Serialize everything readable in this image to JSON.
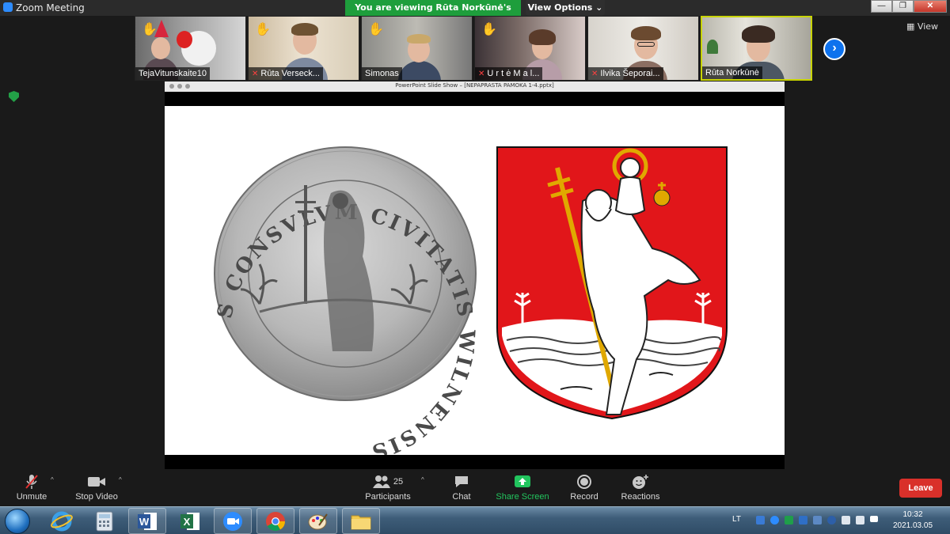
{
  "window": {
    "title": "Zoom Meeting",
    "banner": "You are viewing Rūta Norkūnė's screen",
    "view_options": "View Options",
    "view_options_caret": "⌄",
    "minimize": "—",
    "maximize": "❐",
    "close": "✕"
  },
  "gallery": {
    "participants": [
      {
        "name": "TejaVitunskaite10",
        "muted": false,
        "hand_raised": true
      },
      {
        "name": "Rūta Verseck...",
        "muted": true,
        "hand_raised": true
      },
      {
        "name": "Simonas",
        "muted": false,
        "hand_raised": true
      },
      {
        "name": "U r t ė   M a l...",
        "muted": true,
        "hand_raised": true
      },
      {
        "name": "Ilvika Šeporai...",
        "muted": true,
        "hand_raised": false
      },
      {
        "name": "Rūta Norkūnė",
        "muted": false,
        "hand_raised": false
      }
    ],
    "next_label": "›",
    "view_label": "View",
    "hand_icon": "✋",
    "mic_off_icon": "🎤"
  },
  "share": {
    "window_title": "PowerPoint Slide Show – [NEPAPRASTA PAMOKA 1-4.pptx]",
    "seal_text": "S CONSVLVM CIVITATIS WILNENSIS"
  },
  "toolbar": {
    "unmute": "Unmute",
    "stop_video": "Stop Video",
    "participants": "Participants",
    "participants_count": "25",
    "chat": "Chat",
    "share_screen": "Share Screen",
    "record": "Record",
    "reactions": "Reactions",
    "leave": "Leave",
    "caret": "^"
  },
  "taskbar": {
    "apps": [
      "ie-icon",
      "calculator-icon",
      "word-icon",
      "excel-icon",
      "zoom-icon",
      "chrome-icon",
      "paint-icon",
      "explorer-icon"
    ],
    "language": "LT",
    "time": "10:32",
    "date": "2021.03.05"
  },
  "colors": {
    "banner_green": "#1e9e3c",
    "leave_red": "#d9302a",
    "share_green": "#22c55e",
    "coat_red": "#e1161a",
    "halo_gold": "#e0a800"
  }
}
